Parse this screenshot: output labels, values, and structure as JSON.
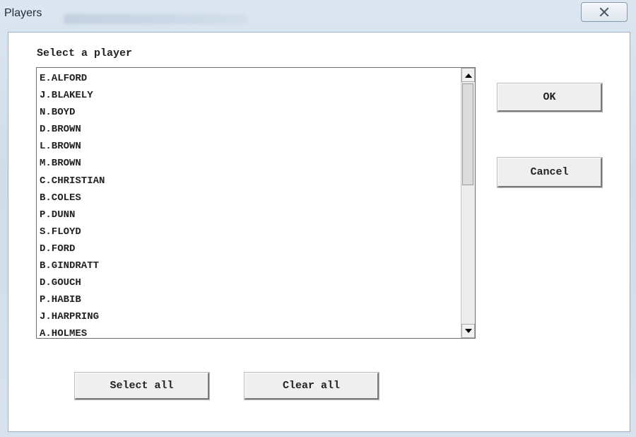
{
  "window": {
    "title": "Players",
    "close_icon": "close-x-icon"
  },
  "dialog": {
    "prompt": "Select a player",
    "players": [
      "E.ALFORD",
      "J.BLAKELY",
      "N.BOYD",
      "D.BROWN",
      "L.BROWN",
      "M.BROWN",
      "C.CHRISTIAN",
      "B.COLES",
      "P.DUNN",
      "S.FLOYD",
      "D.FORD",
      "B.GINDRATT",
      "D.GOUCH",
      "P.HABIB",
      "J.HARPRING",
      "A.HOLMES"
    ],
    "scroll_up_icon": "arrow-up-icon",
    "scroll_down_icon": "arrow-down-icon"
  },
  "buttons": {
    "ok": "OK",
    "cancel": "Cancel",
    "select_all": "Select all",
    "clear_all": "Clear all"
  }
}
